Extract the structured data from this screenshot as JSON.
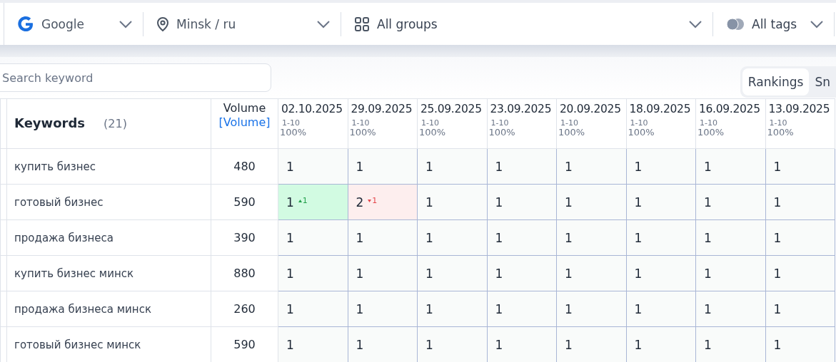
{
  "filters": [
    {
      "kind": "engine",
      "label": "Google"
    },
    {
      "kind": "location",
      "label": "Minsk / ru"
    },
    {
      "kind": "groups",
      "label": "All groups"
    },
    {
      "kind": "tags",
      "label": "All tags"
    }
  ],
  "search": {
    "placeholder": "Search keyword"
  },
  "view_tabs": [
    {
      "label": "Rankings",
      "selected": true
    },
    {
      "label": "Sn",
      "selected": false
    }
  ],
  "table": {
    "keywords_header": "Keywords",
    "keywords_count": "(21)",
    "volume_header": "Volume",
    "volume_link": "[Volume]",
    "dates": [
      {
        "date": "02.10.2025",
        "range": "1-10",
        "share": "100%"
      },
      {
        "date": "29.09.2025",
        "range": "1-10",
        "share": "100%"
      },
      {
        "date": "25.09.2025",
        "range": "1-10",
        "share": "100%"
      },
      {
        "date": "23.09.2025",
        "range": "1-10",
        "share": "100%"
      },
      {
        "date": "20.09.2025",
        "range": "1-10",
        "share": "100%"
      },
      {
        "date": "18.09.2025",
        "range": "1-10",
        "share": "100%"
      },
      {
        "date": "16.09.2025",
        "range": "1-10",
        "share": "100%"
      },
      {
        "date": "13.09.2025",
        "range": "1-10",
        "share": "100%"
      }
    ],
    "rows": [
      {
        "keyword": "купить бизнес",
        "volume": "480",
        "positions": [
          {
            "value": "1"
          },
          {
            "value": "1"
          },
          {
            "value": "1"
          },
          {
            "value": "1"
          },
          {
            "value": "1"
          },
          {
            "value": "1"
          },
          {
            "value": "1"
          },
          {
            "value": "1"
          }
        ]
      },
      {
        "keyword": "готовый бизнес",
        "volume": "590",
        "positions": [
          {
            "value": "1",
            "kind": "up",
            "change": "1"
          },
          {
            "value": "2",
            "kind": "down",
            "change": "1"
          },
          {
            "value": "1"
          },
          {
            "value": "1"
          },
          {
            "value": "1"
          },
          {
            "value": "1"
          },
          {
            "value": "1"
          },
          {
            "value": "1"
          }
        ]
      },
      {
        "keyword": "продажа бизнеса",
        "volume": "390",
        "positions": [
          {
            "value": "1"
          },
          {
            "value": "1"
          },
          {
            "value": "1"
          },
          {
            "value": "1"
          },
          {
            "value": "1"
          },
          {
            "value": "1"
          },
          {
            "value": "1"
          },
          {
            "value": "1"
          }
        ]
      },
      {
        "keyword": "купить бизнес минск",
        "volume": "880",
        "positions": [
          {
            "value": "1"
          },
          {
            "value": "1"
          },
          {
            "value": "1"
          },
          {
            "value": "1"
          },
          {
            "value": "1"
          },
          {
            "value": "1"
          },
          {
            "value": "1"
          },
          {
            "value": "1"
          }
        ]
      },
      {
        "keyword": "продажа бизнеса минск",
        "volume": "260",
        "positions": [
          {
            "value": "1"
          },
          {
            "value": "1"
          },
          {
            "value": "1"
          },
          {
            "value": "1"
          },
          {
            "value": "1"
          },
          {
            "value": "1"
          },
          {
            "value": "1"
          },
          {
            "value": "1"
          }
        ]
      },
      {
        "keyword": "готовый бизнес минск",
        "volume": "590",
        "positions": [
          {
            "value": "1"
          },
          {
            "value": "1"
          },
          {
            "value": "1"
          },
          {
            "value": "1"
          },
          {
            "value": "1"
          },
          {
            "value": "1"
          },
          {
            "value": "1"
          },
          {
            "value": "1"
          }
        ]
      }
    ]
  }
}
